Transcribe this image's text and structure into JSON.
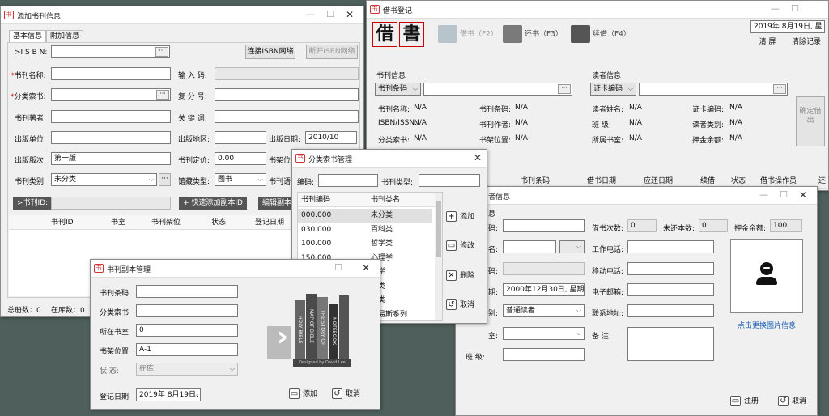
{
  "win_add": {
    "title": "添加书刊信息",
    "tabs": [
      "基本信息",
      "附加信息"
    ],
    "isbn_label": ">I S B N:",
    "connect_btn": "连接ISBN网络",
    "disconnect_btn": "断开ISBN网络",
    "title_label": "书刊名称:",
    "input_code_label": "输 入 码:",
    "class_label": "分类索书:",
    "reissue_label": "复 分 号:",
    "author_label": "书刊著者:",
    "keyword_label": "关 键 词:",
    "publisher_label": "出版单位:",
    "region_label": "出版地区:",
    "pubdate_label": "出版日期:",
    "pubdate_value": "2010/10",
    "edition_label": "出版版次:",
    "edition_value": "第一版",
    "price_label": "书刊定价:",
    "price_value": "0.00",
    "shelf_label": "书架位",
    "type_label": "书刊类别:",
    "type_value": "未分类",
    "storage_label": "馆藏类型:",
    "storage_value": "图书",
    "misc_label": "书刊语",
    "bookid_label": ">书刊ID:",
    "quick_add_btn": "+ 快速添加副本ID",
    "edit_copy_btn": "编辑副本",
    "cols": [
      "书刊ID",
      "书室",
      "书刊架位",
      "状态",
      "登记日期"
    ],
    "status_total": "总册数：0",
    "status_in": "在库数：0"
  },
  "win_borrow": {
    "title": "借书登记",
    "logo": [
      "借",
      "書"
    ],
    "toolbar": [
      "借书（F2）",
      "还书（F3）",
      "续借（F4）"
    ],
    "date_value": "2019年 8月19日, 星",
    "clear_btn": "清  屏",
    "clear_rec_btn": "清除记录",
    "book_section": "书刊信息",
    "book_key_select": "书刊条码",
    "book_fields": [
      {
        "label": "书刊名称:",
        "value": "N/A"
      },
      {
        "label": "书刊条码:",
        "value": "N/A"
      },
      {
        "label": "ISBN/ISSN:",
        "value": "N/A"
      },
      {
        "label": "书刊作者:",
        "value": "N/A"
      },
      {
        "label": "分类索书:",
        "value": "N/A"
      },
      {
        "label": "书架位置:",
        "value": "N/A"
      }
    ],
    "reader_section": "读者信息",
    "reader_key_select": "证卡编码",
    "reader_fields": [
      {
        "label": "读者姓名:",
        "value": "N/A"
      },
      {
        "label": "证卡编码:",
        "value": "N/A"
      },
      {
        "label": "班    级:",
        "value": "N/A"
      },
      {
        "label": "读者类别:",
        "value": "N/A"
      },
      {
        "label": "所属书室:",
        "value": "N/A"
      },
      {
        "label": "押金余额:",
        "value": "N/A"
      }
    ],
    "confirm_btn": "确定借出",
    "cols": [
      "书刊条码",
      "借书日期",
      "应还日期",
      "续借",
      "状态",
      "借书操作员",
      "还"
    ]
  },
  "win_class": {
    "title": "分类索书管理",
    "code_label": "编码:",
    "type_label": "书刊类型:",
    "cols": [
      "书刊编码",
      "书刊类名"
    ],
    "rows": [
      [
        "000.000",
        "未分类"
      ],
      [
        "030.000",
        "百科类"
      ],
      [
        "100.000",
        "哲学类"
      ],
      [
        "150.000",
        "心理学"
      ],
      [
        "",
        "哲学"
      ],
      [
        "",
        "教类"
      ],
      [
        "",
        "学类"
      ],
      [
        "",
        "路易斯系列"
      ]
    ],
    "add": "添加",
    "modify": "修改",
    "delete": "删除",
    "cancel": "取消"
  },
  "win_reader": {
    "title_partial": "者信息",
    "group_partial": "息",
    "code_label": "码:",
    "borrow_count_label": "借书次数:",
    "borrow_count": "0",
    "unreturned_label": "未还本数:",
    "unreturned": "0",
    "deposit_label": "押金余额:",
    "deposit": "100",
    "name_label": "名:",
    "work_phone_label": "工作电话:",
    "code2_label": "码:",
    "mobile_label": "移动电话:",
    "date_label": "期:",
    "date_value": "2000年12月30日, 星期",
    "email_label": "电子邮箱:",
    "category_label": "别:",
    "category_value": "普通读者",
    "address_label": "联系地址:",
    "room_label": "室:",
    "remark_label": "备    注:",
    "class_label": "班    级:",
    "change_photo": "点击更换图片信息",
    "cancel_reg": "注册",
    "cancel": "取消"
  },
  "win_copy": {
    "title": "书刊副本管理",
    "barcode_label": "书刊条码:",
    "class_label": "分类索书:",
    "room_label": "所在书室:",
    "room_value": "0",
    "shelf_label": "书架位置:",
    "shelf_value": "A-1",
    "status_label": "状    态:",
    "status_value": "在库",
    "regdate_label": "登记日期:",
    "regdate_value": "2019年 8月19日,",
    "add": "添加",
    "cancel": "取消",
    "books": [
      "HOLY BIBLE",
      "MAP OF BIBLE",
      "THE STORY OF",
      "NOTEBOOK"
    ],
    "designer": "Designed by David.Lee"
  }
}
